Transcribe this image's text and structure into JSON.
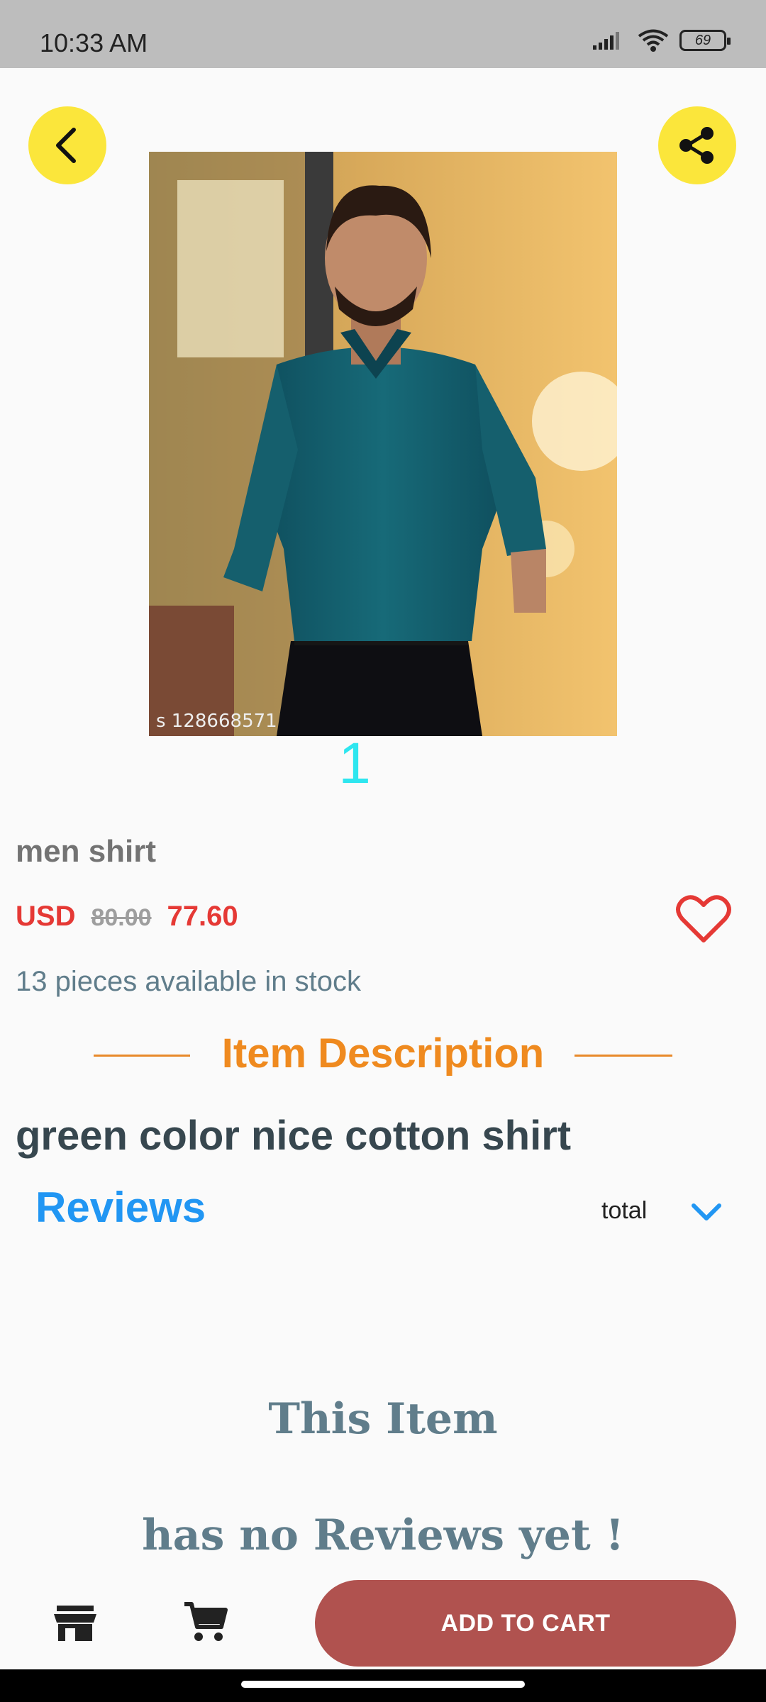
{
  "status_bar": {
    "time": "10:33 AM",
    "battery": "69"
  },
  "product": {
    "image_watermark": "s 128668571",
    "image_index": "1",
    "name": "men shirt",
    "currency": "USD",
    "old_price": "80.00",
    "new_price": "77.60",
    "stock_text": "13 pieces available in stock"
  },
  "description_section": {
    "title": "Item Description",
    "text": "green color nice cotton shirt"
  },
  "reviews": {
    "title": "Reviews",
    "filter_label": "total",
    "empty_line1": "This Item",
    "empty_line2": "has no Reviews yet !"
  },
  "bottom_bar": {
    "add_to_cart_label": "ADD TO CART"
  },
  "colors": {
    "accent_yellow": "#fbe63b",
    "price_red": "#e53935",
    "section_orange": "#ef8a1f",
    "reviews_blue": "#2196f3",
    "cart_button": "#b0524f"
  },
  "icons": [
    "back-arrow-icon",
    "share-icon",
    "heart-icon",
    "chevron-down-icon",
    "store-icon",
    "cart-icon",
    "signal-icon",
    "wifi-icon",
    "battery-icon"
  ]
}
